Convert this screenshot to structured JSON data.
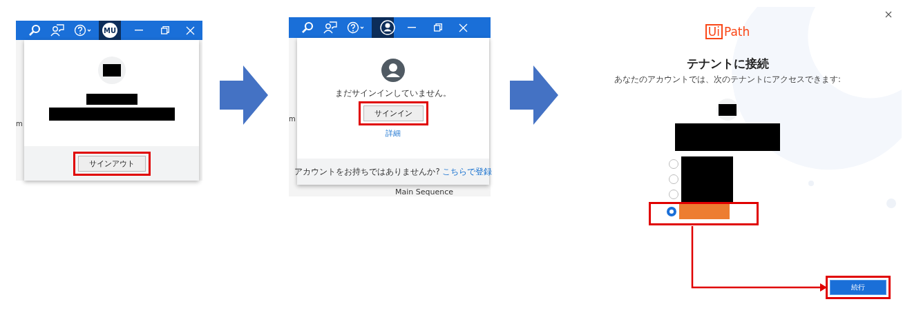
{
  "panel_1": {
    "avatar_initials": "MU",
    "background_text": "m",
    "button": "サインアウト"
  },
  "panel_2": {
    "background_text": "m",
    "message": "まだサインインしていません。",
    "button": "サインイン",
    "details_link": "詳細",
    "footer_text": "アカウントをお持ちではありませんか?",
    "register_link": "こちらで登録",
    "background_row": "Main Sequence"
  },
  "panel_3": {
    "logo_box": "Ui",
    "logo_text": "Path",
    "title": "テナントに接続",
    "subtitle": "あなたのアカウントでは、次のテナントにアクセスできます:",
    "tenants": [
      {
        "selected": false
      },
      {
        "selected": false
      },
      {
        "selected": false
      },
      {
        "selected": true
      }
    ],
    "button": "続行"
  }
}
